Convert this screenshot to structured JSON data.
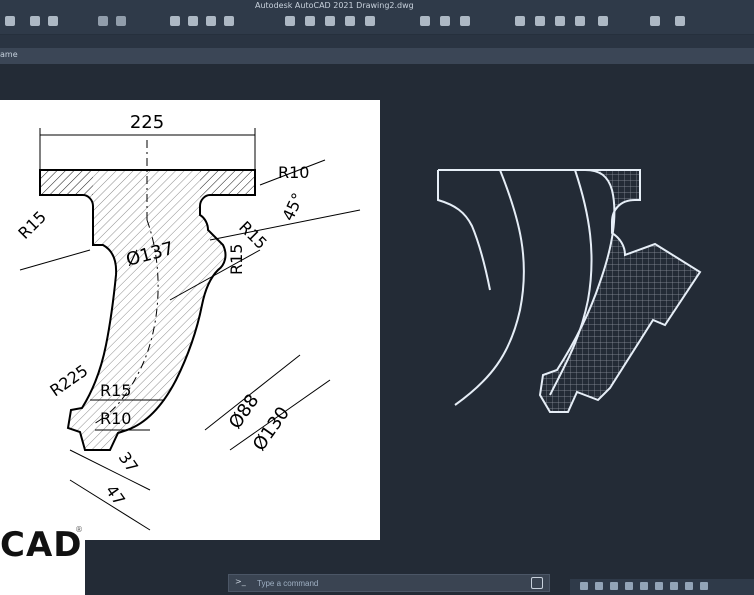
{
  "window": {
    "title": "Autodesk AutoCAD 2021    Drawing2.dwg"
  },
  "tabs": {
    "model_tab_label": "ame"
  },
  "reference_drawing": {
    "dimensions": {
      "top_width": "225",
      "r10_top": "R10",
      "r15_left": "R15",
      "r15_mid": "R15",
      "r15_right": "R15",
      "angle": "45°",
      "diameter_137": "Ø137",
      "r225": "R225",
      "r15_bottom": "R15",
      "r10_bottom": "R10",
      "dim_37": "37",
      "dim_47": "47",
      "diameter_88": "Ø88",
      "diameter_130": "Ø130"
    }
  },
  "branding": {
    "logo_text": "CAD",
    "logo_mark": "®"
  },
  "command_line": {
    "prompt": ">_ ",
    "placeholder": "Type a command"
  }
}
